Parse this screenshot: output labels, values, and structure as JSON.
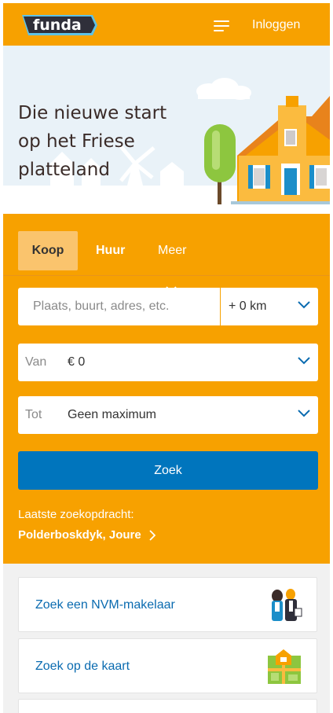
{
  "header": {
    "logo_text": "funda",
    "menu_icon": "hamburger-icon",
    "login_label": "Inloggen",
    "background_color": "#f7a100"
  },
  "hero": {
    "title": "Die nieuwe start op het Friese platteland"
  },
  "tabs": [
    {
      "label": "Koop",
      "active": true
    },
    {
      "label": "Huur",
      "active": false
    },
    {
      "label": "Meer",
      "active": false,
      "icon": "chevron-down-icon"
    }
  ],
  "search": {
    "location_placeholder": "Plaats, buurt, adres, etc.",
    "radius_value": "+ 0 km",
    "price_from_label": "Van",
    "price_from_value": "€ 0",
    "price_to_label": "Tot",
    "price_to_value": "Geen maximum",
    "submit_label": "Zoek",
    "submit_color": "#0075bd"
  },
  "last_search": {
    "label": "Laatste zoekopdracht:",
    "value": "Polderboskdyk, Joure"
  },
  "cards": [
    {
      "label": "Zoek een NVM-makelaar",
      "icon": "agents-illustration"
    },
    {
      "label": "Zoek op de kaart",
      "icon": "map-illustration"
    }
  ]
}
